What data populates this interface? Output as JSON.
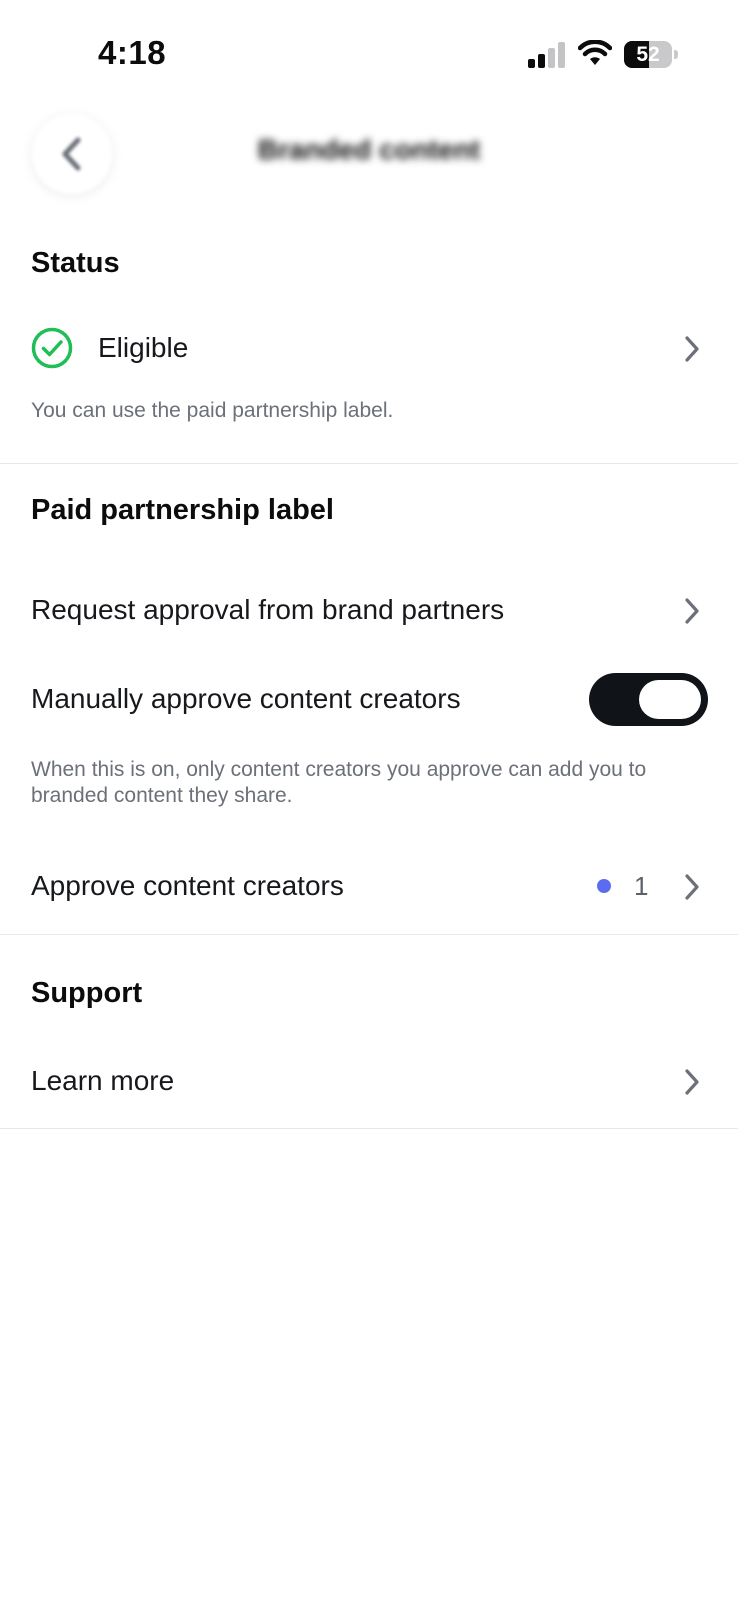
{
  "status_bar": {
    "time": "4:18",
    "battery_level": 52,
    "battery_text": "52"
  },
  "nav": {
    "title": "Branded content",
    "back_icon": "chevron-left-icon"
  },
  "status_section": {
    "title": "Status",
    "eligibility_label": "Eligible",
    "eligibility_icon": "check-circle-icon",
    "caption": "You can use the paid partnership label."
  },
  "partnership_section": {
    "title": "Paid partnership label",
    "request_approval_label": "Request approval from brand partners",
    "manual_approve_label": "Manually approve content creators",
    "manual_approve_on": true,
    "manual_approve_caption": "When this is on, only content creators you approve can add you to branded content they share.",
    "approve_creators_label": "Approve content creators",
    "approve_creators_count": "1"
  },
  "support_section": {
    "title": "Support",
    "learn_more_label": "Learn more"
  },
  "colors": {
    "accent_green": "#1fbe57",
    "notification_dot": "#5b6cf0",
    "toggle_on": "#101418",
    "chevron": "#6b7079"
  }
}
